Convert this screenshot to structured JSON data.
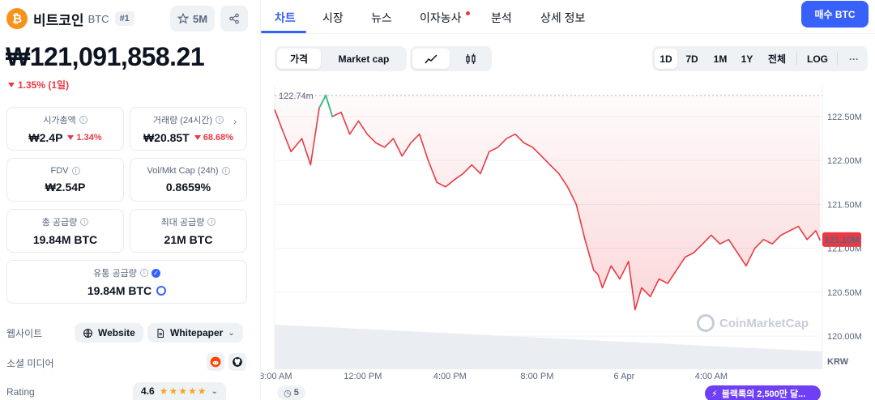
{
  "coin": {
    "logo_glyph": "₿",
    "name": "비트코인",
    "symbol": "BTC",
    "rank": "#1",
    "watchlist_count": "5M",
    "price": "₩121,091,858.21",
    "change": "1.35% (1일)",
    "change_color": "#ea3943"
  },
  "stats": {
    "market_cap": {
      "label": "시가총액",
      "value": "₩2.4P",
      "delta": "1.34%"
    },
    "volume": {
      "label": "거래량 (24시간)",
      "value": "₩20.85T",
      "delta": "68.68%"
    },
    "fdv": {
      "label": "FDV",
      "value": "₩2.54P"
    },
    "vol_mkt_cap": {
      "label": "Vol/Mkt Cap (24h)",
      "value": "0.8659%"
    },
    "total_supply": {
      "label": "총 공급량",
      "value": "19.84M BTC"
    },
    "max_supply": {
      "label": "최대 공급량",
      "value": "21M BTC"
    },
    "circulating": {
      "label": "유통 공급량",
      "value": "19.84M BTC"
    }
  },
  "links": {
    "website_label": "웹사이트",
    "website_btn": "Website",
    "whitepaper_btn": "Whitepaper",
    "social_label": "소셜 미디어",
    "rating_label": "Rating",
    "rating_value": "4.6",
    "rating_stars": 4.6
  },
  "tabs": [
    {
      "label": "차트"
    },
    {
      "label": "시장"
    },
    {
      "label": "뉴스"
    },
    {
      "label": "이자농사"
    },
    {
      "label": "분석"
    },
    {
      "label": "상세 정보"
    }
  ],
  "buy_button": "매수 BTC",
  "toolbar": {
    "price_tab": "가격",
    "mcap_tab": "Market cap",
    "ranges": [
      "1D",
      "7D",
      "1M",
      "1Y",
      "전체",
      "LOG"
    ],
    "active_range": "1D"
  },
  "chart_data": {
    "type": "line",
    "currency": "KRW",
    "ylim": [
      119.9,
      122.85
    ],
    "yticks": [
      "122.50M",
      "122.00M",
      "121.50M",
      "121.00M",
      "120.50M",
      "120.00M"
    ],
    "ytick_values": [
      122.5,
      122.0,
      121.5,
      121.0,
      120.5,
      120.0
    ],
    "xticks": [
      "8:00 AM",
      "12:00 PM",
      "4:00 PM",
      "8:00 PM",
      "6 Apr",
      "4:00 AM"
    ],
    "xtick_hours": [
      8,
      12,
      16,
      20,
      24,
      28
    ],
    "x_hours": [
      7.95,
      8.3,
      8.7,
      9.2,
      9.6,
      10.0,
      10.3,
      10.6,
      11.0,
      11.4,
      11.8,
      12.2,
      12.6,
      13.0,
      13.4,
      13.8,
      14.2,
      14.6,
      15.0,
      15.4,
      15.8,
      16.2,
      16.6,
      17.0,
      17.4,
      17.8,
      18.2,
      18.6,
      19.0,
      19.4,
      19.8,
      20.2,
      20.6,
      21.0,
      21.4,
      21.8,
      22.2,
      22.6,
      22.8,
      23.0,
      23.4,
      23.8,
      24.2,
      24.5,
      24.8,
      25.2,
      25.6,
      26.0,
      26.4,
      26.8,
      27.2,
      27.6,
      28.0,
      28.4,
      28.8,
      29.2,
      29.6,
      30.0,
      30.4,
      30.8,
      31.2,
      31.6,
      32.0,
      32.4,
      32.8,
      33.0
    ],
    "values": [
      122.58,
      122.35,
      122.1,
      122.25,
      121.95,
      122.6,
      122.74,
      122.5,
      122.55,
      122.3,
      122.45,
      122.3,
      122.2,
      122.15,
      122.25,
      122.05,
      122.2,
      122.3,
      122.0,
      121.75,
      121.7,
      121.78,
      121.85,
      121.95,
      121.85,
      122.1,
      122.15,
      122.25,
      122.3,
      122.2,
      122.15,
      122.05,
      121.95,
      121.85,
      121.7,
      121.5,
      121.1,
      120.75,
      120.7,
      120.55,
      120.8,
      120.65,
      120.85,
      120.3,
      120.55,
      120.45,
      120.65,
      120.6,
      120.75,
      120.9,
      120.95,
      121.05,
      121.15,
      121.05,
      121.1,
      120.95,
      120.8,
      121.0,
      121.1,
      121.05,
      121.15,
      121.2,
      121.25,
      121.1,
      121.2,
      121.09
    ],
    "high_label": "122.74m",
    "high_value": 122.74,
    "current_label": "121.10M",
    "current_value": 121.1,
    "line_color": "#ea3943",
    "grid": true
  },
  "history_count": "5",
  "promo_text": "블랙록의 2,500만 달...",
  "watermark": "CoinMarketCap"
}
